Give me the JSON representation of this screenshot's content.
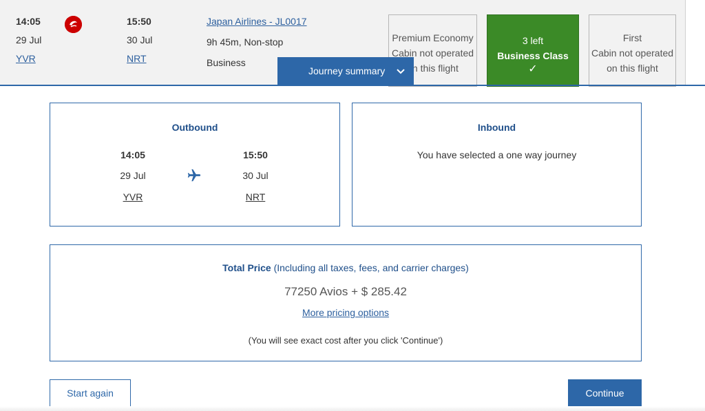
{
  "flight": {
    "depart_time": "14:05",
    "depart_date": "29 Jul",
    "depart_airport": "YVR",
    "arrive_time": "15:50",
    "arrive_date": "30 Jul",
    "arrive_airport": "NRT",
    "airline_link": "Japan Airlines - JL0017",
    "duration": "9h 45m, Non-stop",
    "cabin": "Business",
    "airline_logo_icon": "jal-crane-logo-icon"
  },
  "cabins": [
    {
      "line1": "Premium Economy",
      "line2": "Cabin not operated",
      "line3": "on this flight",
      "state": "not-operated"
    },
    {
      "line1": "3 left",
      "line2": "Business Class",
      "line3": "✓",
      "state": "selected"
    },
    {
      "line1": "First",
      "line2": "Cabin not operated",
      "line3": "on this flight",
      "state": "not-operated"
    }
  ],
  "journey_tab": {
    "label": "Journey summary",
    "icon": "chevron-down-icon"
  },
  "outbound": {
    "title": "Outbound",
    "depart_time": "14:05",
    "depart_date": "29 Jul",
    "depart_airport": "YVR",
    "arrive_time": "15:50",
    "arrive_date": "30 Jul",
    "arrive_airport": "NRT",
    "icon": "airplane-icon"
  },
  "inbound": {
    "title": "Inbound",
    "message": "You have selected a one way journey"
  },
  "price": {
    "label_bold": "Total Price",
    "label_rest": " (Including all taxes, fees, and carrier charges)",
    "value": "77250 Avios + $ 285.42",
    "more_link": "More pricing options",
    "note": "(You will see exact cost after you click 'Continue')"
  },
  "buttons": {
    "start_again": "Start again",
    "continue": "Continue"
  },
  "colors": {
    "primary": "#2d67a8",
    "selected_cabin": "#3b8a27",
    "link": "#2c5f9e",
    "jal_red": "#cc0000"
  }
}
